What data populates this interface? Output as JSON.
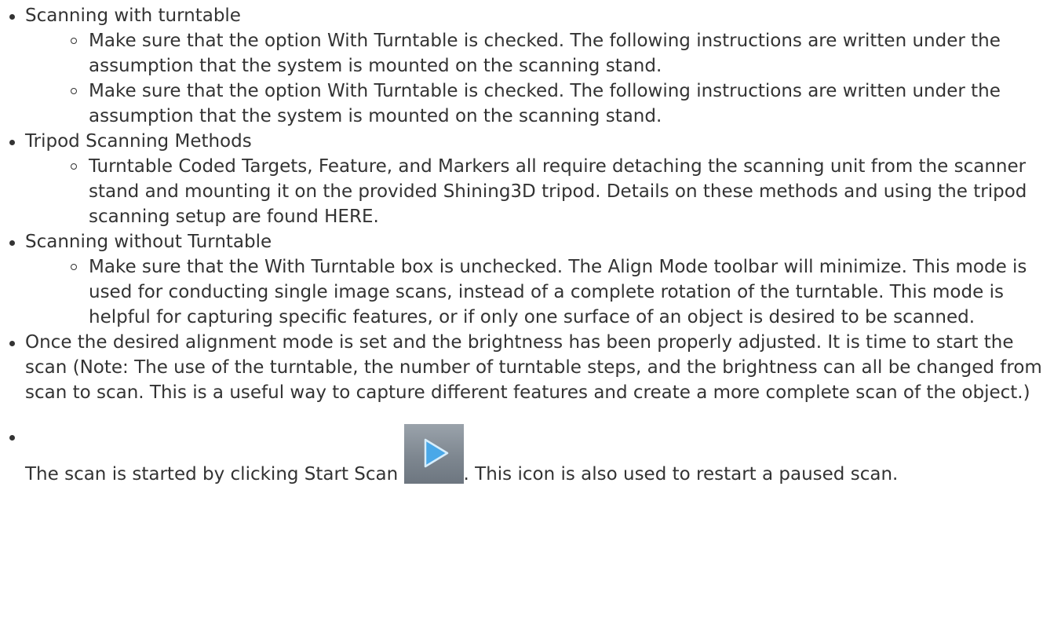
{
  "items": [
    {
      "text": "Scanning with turntable",
      "sub": [
        "Make sure that the option With Turntable is checked. The following instructions are written under the assumption that the system is mounted on the scanning stand.",
        "Make sure that the option With Turntable is checked. The following instructions are written under the assumption that the system is mounted on the scanning stand."
      ]
    },
    {
      "text": "Tripod Scanning Methods",
      "sub": [
        "Turntable Coded Targets, Feature, and Markers all require detaching the scanning unit from the scanner stand and mounting it on the provided Shining3D tripod. Details on these methods and using the tripod scanning setup are found HERE."
      ]
    },
    {
      "text": "Scanning without Turntable",
      "sub": [
        "Make sure that the With Turntable box is unchecked. The Align Mode toolbar will minimize. This mode is used for conducting single image scans, instead of a complete rotation of the turntable. This mode is helpful for capturing specific features, or if only one surface of an object is desired to be scanned."
      ]
    },
    {
      "text": "Once the desired alignment mode is set and the brightness has been properly adjusted. It is time to start the scan (Note: The use of the turntable, the number of turntable steps, and the brightness can all be changed from scan to scan. This is a useful way to capture different features and create a more complete scan of the object.)"
    }
  ],
  "last_item": {
    "before": "The scan is started by clicking Start Scan ",
    "after": ". This icon is also used to restart a paused scan.",
    "icon": "play-icon"
  },
  "colors": {
    "text": "#333333",
    "icon_bg": "#7e8790",
    "icon_play": "#4aa8e8"
  }
}
